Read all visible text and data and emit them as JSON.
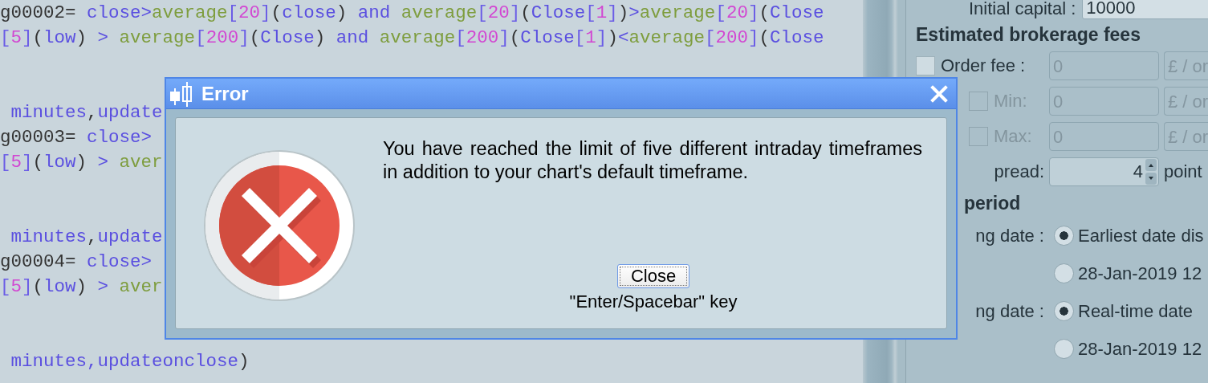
{
  "editor": {
    "lines": [
      {
        "kind": "code",
        "tokens": [
          {
            "text": "g00002= ",
            "kind": "plain"
          },
          {
            "text": "close>",
            "kind": "keyword"
          },
          {
            "text": "average",
            "kind": "function"
          },
          {
            "text": "[",
            "kind": "bracket"
          },
          {
            "text": "20",
            "kind": "number"
          },
          {
            "text": "]",
            "kind": "bracket"
          },
          {
            "text": "(",
            "kind": "plain"
          },
          {
            "text": "close",
            "kind": "keyword"
          },
          {
            "text": ") ",
            "kind": "plain"
          },
          {
            "text": "and ",
            "kind": "keyword"
          },
          {
            "text": "average",
            "kind": "function"
          },
          {
            "text": "[",
            "kind": "bracket"
          },
          {
            "text": "20",
            "kind": "number"
          },
          {
            "text": "]",
            "kind": "bracket"
          },
          {
            "text": "(",
            "kind": "plain"
          },
          {
            "text": "Close",
            "kind": "keyword"
          },
          {
            "text": "[",
            "kind": "bracket"
          },
          {
            "text": "1",
            "kind": "number"
          },
          {
            "text": "]",
            "kind": "bracket"
          },
          {
            "text": ")",
            "kind": "plain"
          },
          {
            "text": ">",
            "kind": "keyword"
          },
          {
            "text": "average",
            "kind": "function"
          },
          {
            "text": "[",
            "kind": "bracket"
          },
          {
            "text": "20",
            "kind": "number"
          },
          {
            "text": "]",
            "kind": "bracket"
          },
          {
            "text": "(",
            "kind": "plain"
          },
          {
            "text": "Close",
            "kind": "keyword"
          }
        ]
      },
      {
        "kind": "code",
        "tokens": [
          {
            "text": "[",
            "kind": "bracket"
          },
          {
            "text": "5",
            "kind": "number"
          },
          {
            "text": "]",
            "kind": "bracket"
          },
          {
            "text": "(",
            "kind": "plain"
          },
          {
            "text": "low",
            "kind": "keyword"
          },
          {
            "text": ") ",
            "kind": "plain"
          },
          {
            "text": "> ",
            "kind": "keyword"
          },
          {
            "text": "average",
            "kind": "function"
          },
          {
            "text": "[",
            "kind": "bracket"
          },
          {
            "text": "200",
            "kind": "number"
          },
          {
            "text": "]",
            "kind": "bracket"
          },
          {
            "text": "(",
            "kind": "plain"
          },
          {
            "text": "Close",
            "kind": "keyword"
          },
          {
            "text": ") ",
            "kind": "plain"
          },
          {
            "text": "and ",
            "kind": "keyword"
          },
          {
            "text": "average",
            "kind": "function"
          },
          {
            "text": "[",
            "kind": "bracket"
          },
          {
            "text": "200",
            "kind": "number"
          },
          {
            "text": "]",
            "kind": "bracket"
          },
          {
            "text": "(",
            "kind": "plain"
          },
          {
            "text": "Close",
            "kind": "keyword"
          },
          {
            "text": "[",
            "kind": "bracket"
          },
          {
            "text": "1",
            "kind": "number"
          },
          {
            "text": "]",
            "kind": "bracket"
          },
          {
            "text": ")",
            "kind": "plain"
          },
          {
            "text": "<",
            "kind": "keyword"
          },
          {
            "text": "average",
            "kind": "function"
          },
          {
            "text": "[",
            "kind": "bracket"
          },
          {
            "text": "200",
            "kind": "number"
          },
          {
            "text": "]",
            "kind": "bracket"
          },
          {
            "text": "(",
            "kind": "plain"
          },
          {
            "text": "Close",
            "kind": "keyword"
          }
        ]
      },
      {
        "kind": "blank"
      },
      {
        "kind": "blank"
      },
      {
        "kind": "code",
        "tokens": [
          {
            "text": " minutes",
            "kind": "keyword"
          },
          {
            "text": ",",
            "kind": "plain"
          },
          {
            "text": "update",
            "kind": "keyword"
          }
        ]
      },
      {
        "kind": "code",
        "tokens": [
          {
            "text": "g00003= ",
            "kind": "plain"
          },
          {
            "text": "close>",
            "kind": "keyword"
          }
        ]
      },
      {
        "kind": "code",
        "tokens": [
          {
            "text": "[",
            "kind": "bracket"
          },
          {
            "text": "5",
            "kind": "number"
          },
          {
            "text": "]",
            "kind": "bracket"
          },
          {
            "text": "(",
            "kind": "plain"
          },
          {
            "text": "low",
            "kind": "keyword"
          },
          {
            "text": ") ",
            "kind": "plain"
          },
          {
            "text": "> ",
            "kind": "keyword"
          },
          {
            "text": "aver",
            "kind": "function"
          }
        ]
      },
      {
        "kind": "blank"
      },
      {
        "kind": "blank"
      },
      {
        "kind": "code",
        "tokens": [
          {
            "text": " minutes",
            "kind": "keyword"
          },
          {
            "text": ",",
            "kind": "plain"
          },
          {
            "text": "update",
            "kind": "keyword"
          }
        ]
      },
      {
        "kind": "code",
        "tokens": [
          {
            "text": "g00004= ",
            "kind": "plain"
          },
          {
            "text": "close>",
            "kind": "keyword"
          }
        ]
      },
      {
        "kind": "code",
        "tokens": [
          {
            "text": "[",
            "kind": "bracket"
          },
          {
            "text": "5",
            "kind": "number"
          },
          {
            "text": "]",
            "kind": "bracket"
          },
          {
            "text": "(",
            "kind": "plain"
          },
          {
            "text": "low",
            "kind": "keyword"
          },
          {
            "text": ") ",
            "kind": "plain"
          },
          {
            "text": "> ",
            "kind": "keyword"
          },
          {
            "text": "aver",
            "kind": "function"
          }
        ]
      },
      {
        "kind": "blank"
      },
      {
        "kind": "blank"
      },
      {
        "kind": "code",
        "tokens": [
          {
            "text": " minutes,updateonclose",
            "kind": "keyword"
          },
          {
            "text": ")",
            "kind": "plain"
          }
        ]
      }
    ]
  },
  "settings": {
    "initial_capital": {
      "label": "Initial capital :",
      "value": "10000"
    },
    "fees_heading": "Estimated brokerage fees",
    "fees": [
      {
        "kind": "main",
        "label": "Order fee :",
        "checked": false,
        "disabled": false,
        "value": "0",
        "unit": "£ / or"
      },
      {
        "kind": "limit",
        "label": "Min:",
        "checked": false,
        "disabled": true,
        "value": "0",
        "unit": "£ / or"
      },
      {
        "kind": "limit",
        "label": "Max:",
        "checked": false,
        "disabled": true,
        "value": "0",
        "unit": "£ / or"
      }
    ],
    "spread": {
      "label": "pread:",
      "value": "4",
      "unit": "point"
    },
    "period_heading": "period",
    "dates": [
      {
        "label": "ng date :",
        "options": [
          {
            "label": "Earliest date dis",
            "selected": true
          },
          {
            "label": "28-Jan-2019 12",
            "selected": false
          }
        ]
      },
      {
        "label": "ng date :",
        "options": [
          {
            "label": "Real-time date",
            "selected": true
          },
          {
            "label": "28-Jan-2019 12",
            "selected": false
          }
        ]
      }
    ]
  },
  "dialog": {
    "title": "Error",
    "message": "You have reached the limit of five different intraday timeframes in addition to your chart's default timeframe.",
    "button": "Close",
    "hint": "\"Enter/Spacebar\" key"
  }
}
